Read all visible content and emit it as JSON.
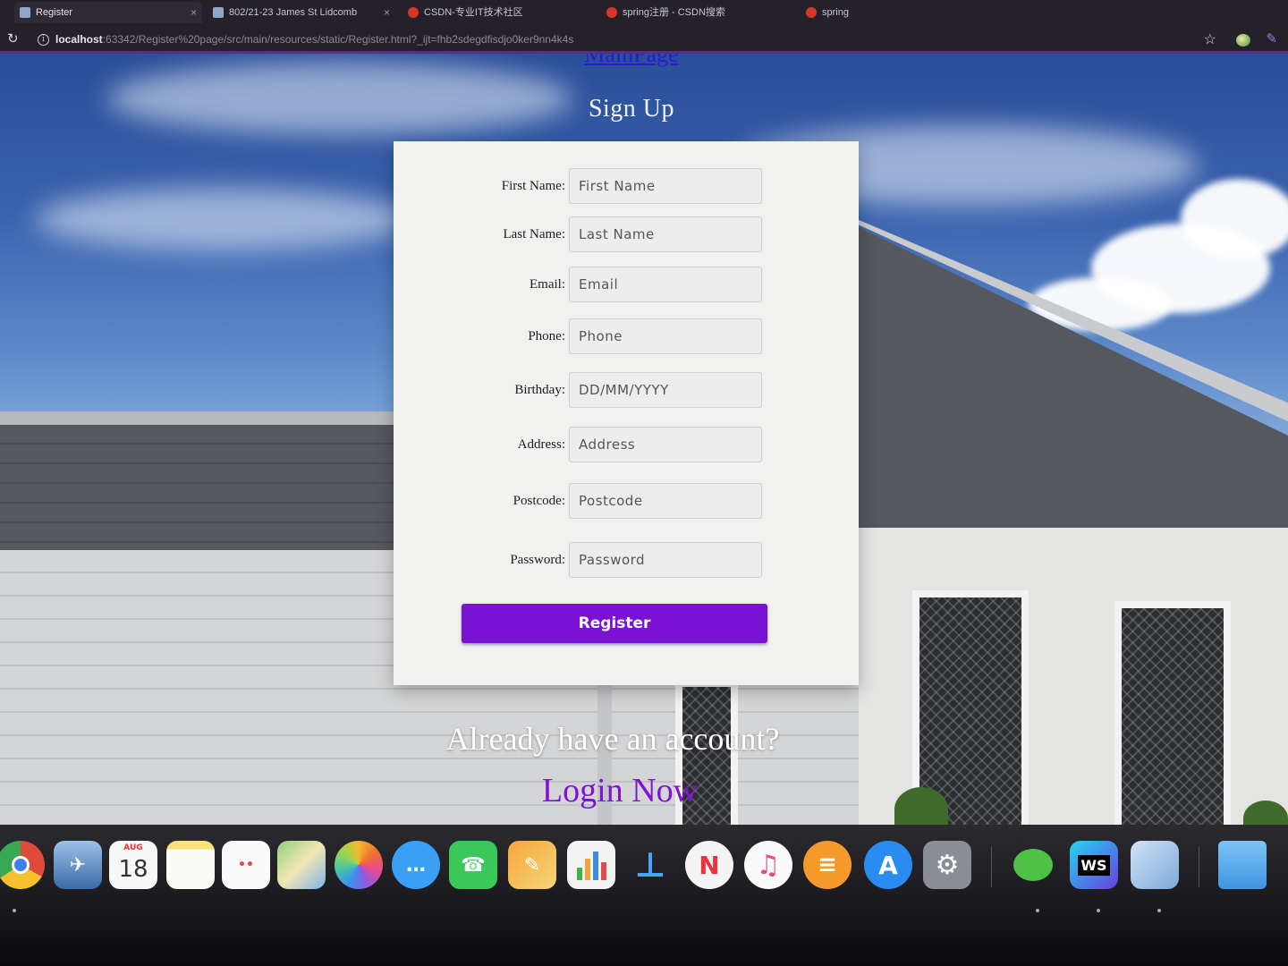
{
  "browser": {
    "tabs": [
      {
        "label": "Register",
        "active": true
      },
      {
        "label": "802/21-23 James St Lidcomb",
        "active": false
      },
      {
        "label": "CSDN-专业IT技术社区",
        "active": false
      },
      {
        "label": "spring注册 - CSDN搜索",
        "active": false
      },
      {
        "label": "spring",
        "active": false
      }
    ],
    "url_host": "localhost",
    "url_path": ":63342/Register%20page/src/main/resources/static/Register.html?_ijt=fhb2sdegdfisdjo0ker9nn4k4s"
  },
  "page": {
    "main_link": "MainPage",
    "title": "Sign Up",
    "form": {
      "fields": [
        {
          "label": "First Name:",
          "placeholder": "First Name"
        },
        {
          "label": "Last Name:",
          "placeholder": "Last Name"
        },
        {
          "label": "Email:",
          "placeholder": "Email"
        },
        {
          "label": "Phone:",
          "placeholder": "Phone"
        },
        {
          "label": "Birthday:",
          "placeholder": "DD/MM/YYYY"
        },
        {
          "label": "Address:",
          "placeholder": "Address"
        },
        {
          "label": "Postcode:",
          "placeholder": "Postcode"
        },
        {
          "label": "Password:",
          "placeholder": "Password"
        }
      ],
      "submit_label": "Register"
    },
    "already_text": "Already have an account?",
    "login_link": "Login Now"
  },
  "dock": {
    "calendar_month": "AUG",
    "calendar_day": "18"
  },
  "colors": {
    "accent_purple": "#7a12d6",
    "link_blue": "#2a1ad8"
  }
}
